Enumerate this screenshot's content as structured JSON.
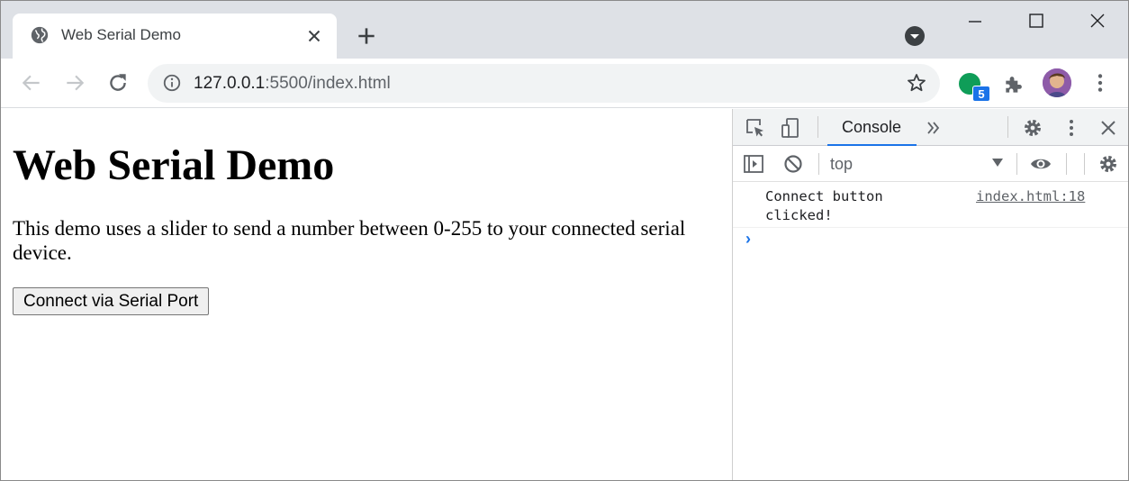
{
  "tab": {
    "title": "Web Serial Demo"
  },
  "address_bar": {
    "host": "127.0.0.1",
    "rest": ":5500/index.html"
  },
  "extensions": {
    "badge_count": "5"
  },
  "page": {
    "heading": "Web Serial Demo",
    "description": "This demo uses a slider to send a number between 0-255 to your connected serial device.",
    "connect_button_label": "Connect via Serial Port"
  },
  "devtools": {
    "active_tab": "Console",
    "context": "top",
    "logs": [
      {
        "message": "Connect button clicked!",
        "source": "index.html:18"
      }
    ],
    "prompt": "›"
  },
  "colors": {
    "accent": "#1a73e8",
    "tabstrip": "#dee1e6",
    "extension": "#0f9d58"
  }
}
